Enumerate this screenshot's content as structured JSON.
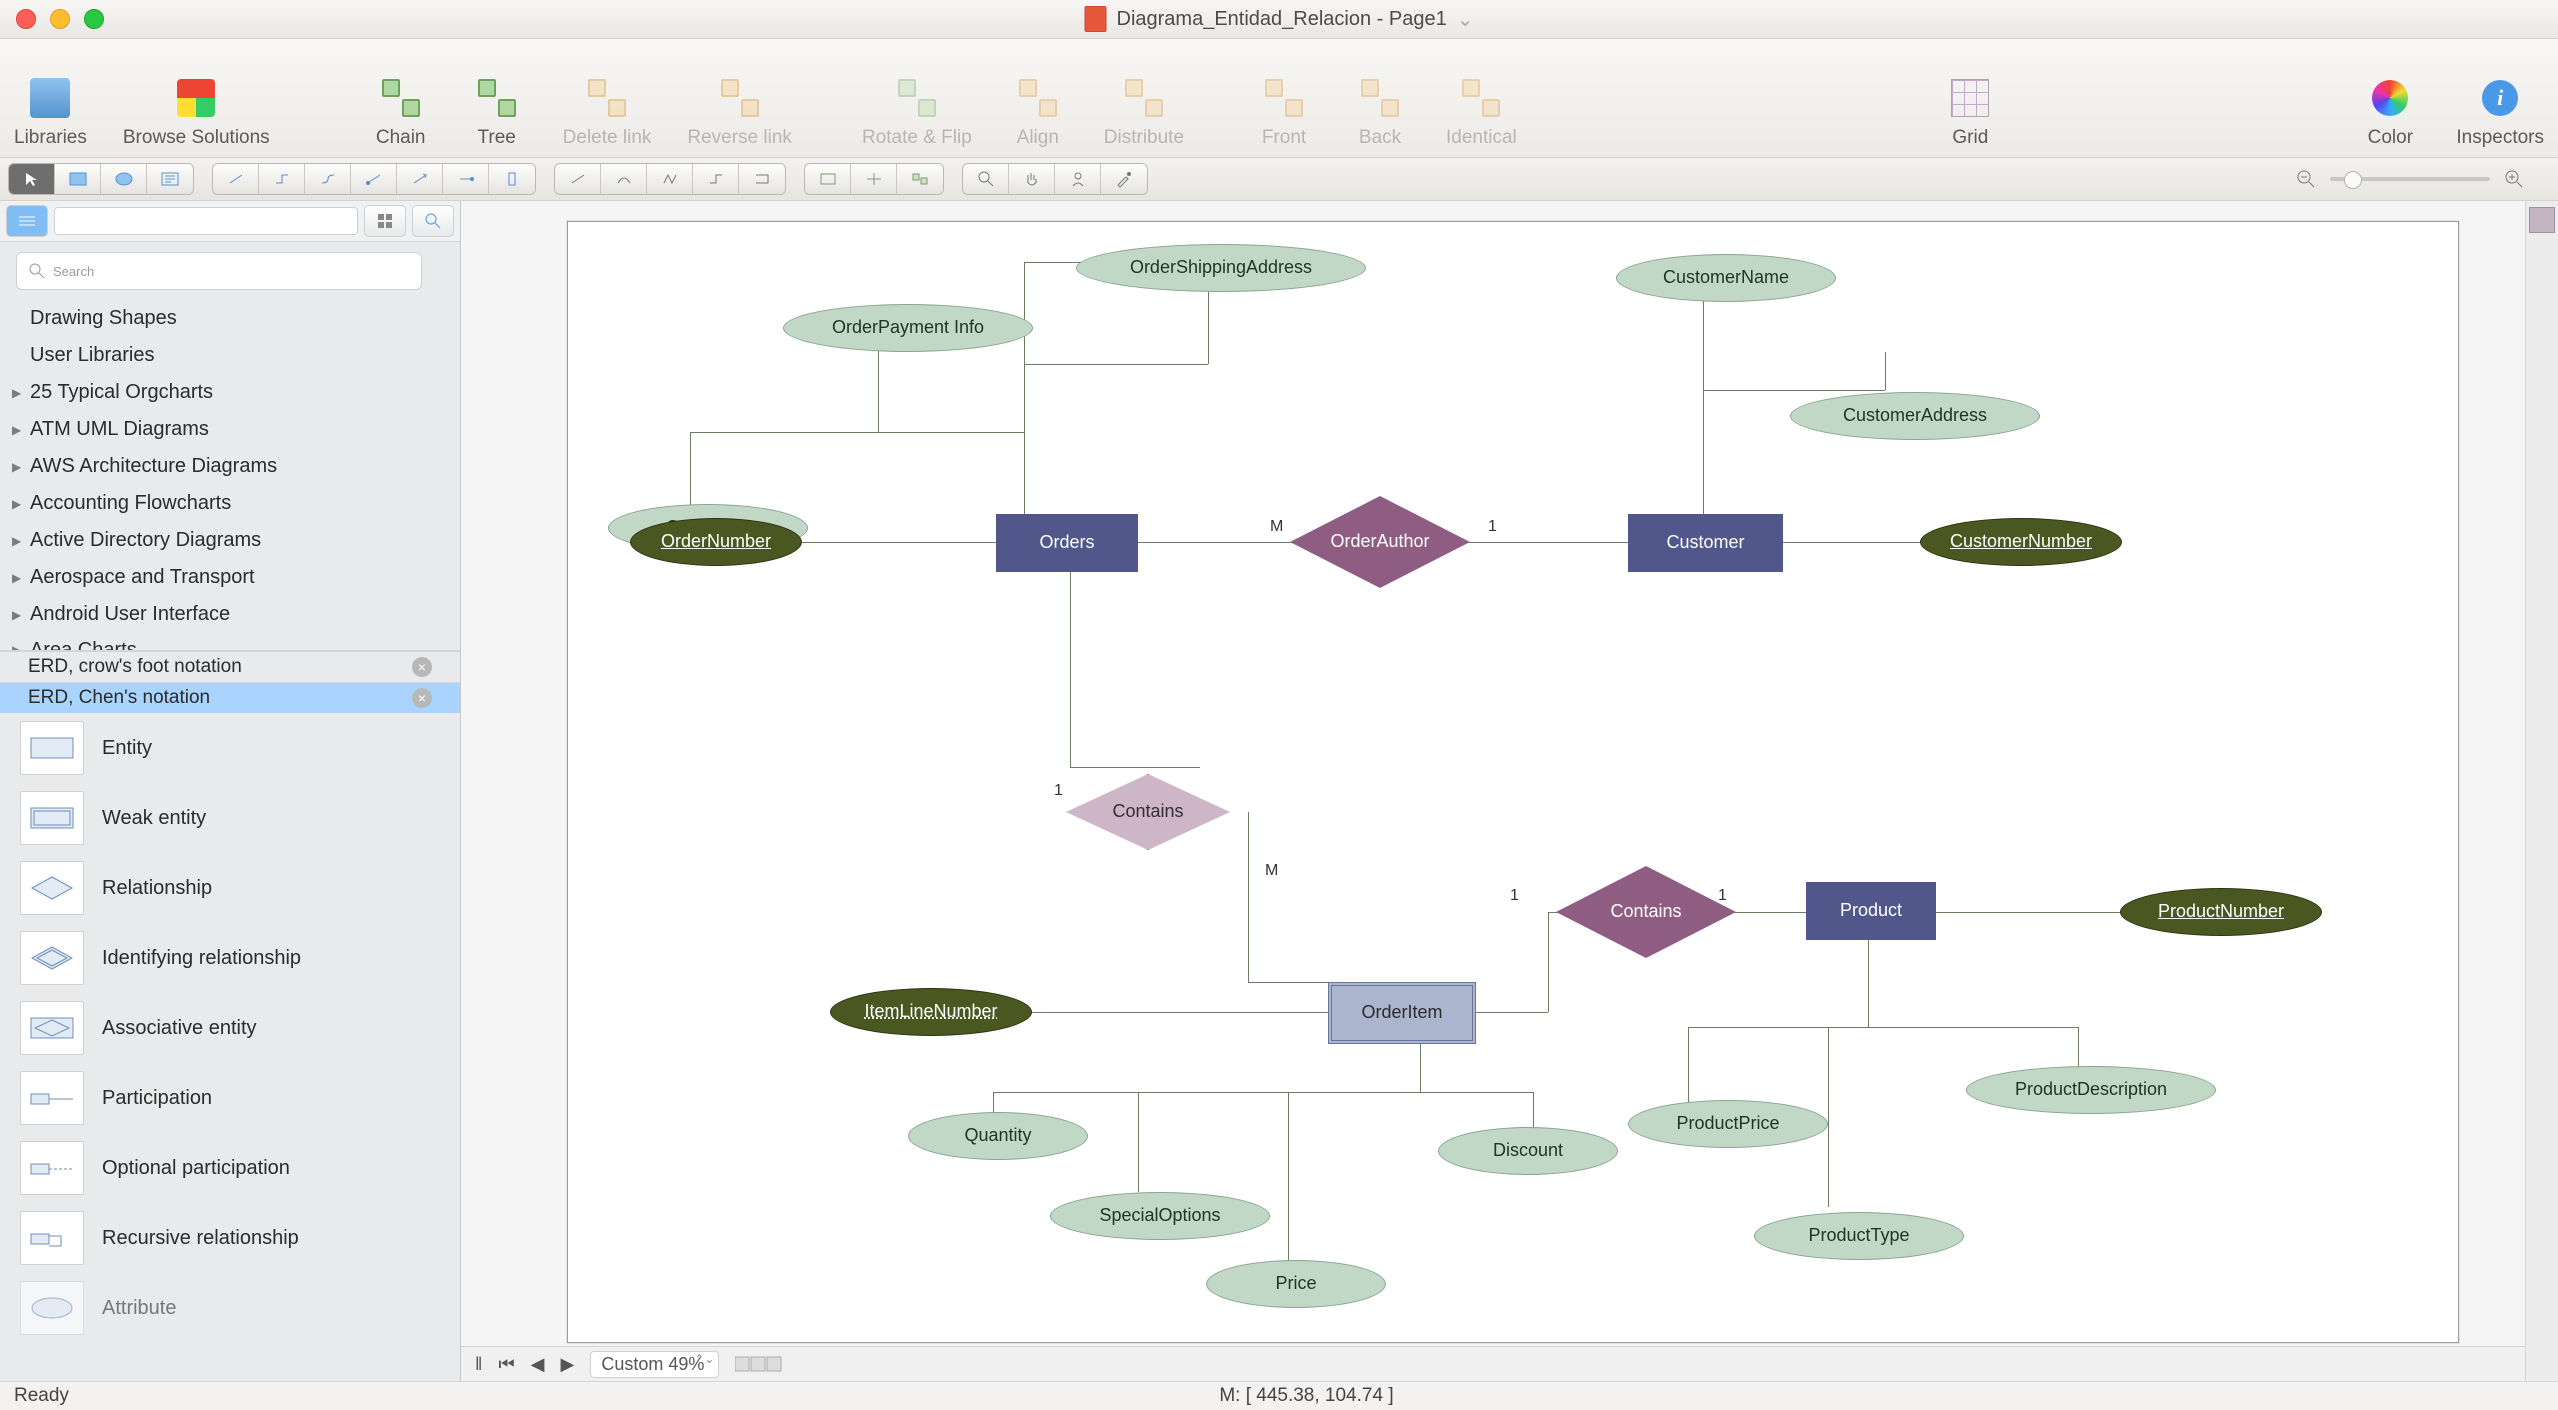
{
  "window": {
    "title": "Diagrama_Entidad_Relacion - Page1"
  },
  "toolbar": {
    "libraries": "Libraries",
    "browse": "Browse Solutions",
    "chain": "Chain",
    "tree": "Tree",
    "delete_link": "Delete link",
    "reverse_link": "Reverse link",
    "rotate_flip": "Rotate & Flip",
    "align": "Align",
    "distribute": "Distribute",
    "front": "Front",
    "back": "Back",
    "identical": "Identical",
    "grid": "Grid",
    "color": "Color",
    "inspectors": "Inspectors"
  },
  "search": {
    "placeholder": "Search"
  },
  "libs": {
    "drawing_shapes": "Drawing Shapes",
    "user_libraries": "User Libraries",
    "items": [
      "25 Typical Orgcharts",
      "ATM UML Diagrams",
      "AWS Architecture Diagrams",
      "Accounting Flowcharts",
      "Active Directory Diagrams",
      "Aerospace and Transport",
      "Android User Interface",
      "Area Charts"
    ],
    "tab_crows": "ERD, crow's foot notation",
    "tab_chen": "ERD, Chen's notation"
  },
  "shapes": [
    "Entity",
    "Weak entity",
    "Relationship",
    "Identifying relationship",
    "Associative entity",
    "Participation",
    "Optional participation",
    "Recursive relationship",
    "Attribute"
  ],
  "diagram": {
    "orders": "Orders",
    "customer": "Customer",
    "product": "Product",
    "orderitem": "OrderItem",
    "ordernumber": "OrderNumber",
    "customernumber": "CustomerNumber",
    "productnumber": "ProductNumber",
    "itemlinenumber": "ItemLineNumber",
    "orderdate": "OrderDate",
    "orderpayment": "OrderPayment Info",
    "ordershipping": "OrderShippingAddress",
    "customername": "CustomerName",
    "customeraddress": "CustomerAddress",
    "productprice": "ProductPrice",
    "producttype": "ProductType",
    "productdesc": "ProductDescription",
    "quantity": "Quantity",
    "specialoptions": "SpecialOptions",
    "price": "Price",
    "discount": "Discount",
    "orderauthor": "OrderAuthor",
    "contains1": "Contains",
    "contains2": "Contains",
    "card": {
      "M": "M",
      "one": "1"
    }
  },
  "bottom": {
    "zoom": "Custom 49%"
  },
  "status": {
    "ready": "Ready",
    "coords": "M: [ 445.38, 104.74 ]"
  }
}
